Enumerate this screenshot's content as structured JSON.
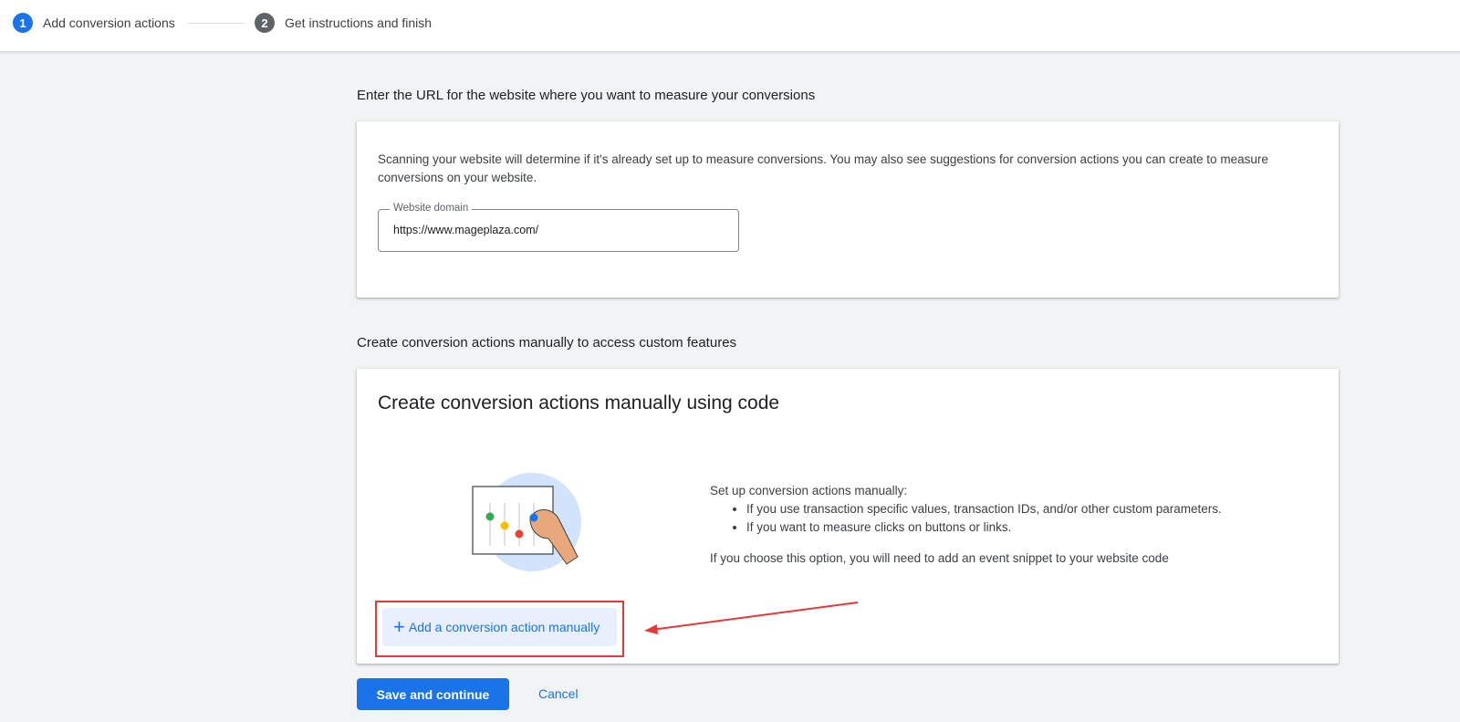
{
  "stepper": {
    "steps": [
      {
        "number": "1",
        "label": "Add conversion actions"
      },
      {
        "number": "2",
        "label": "Get instructions and finish"
      }
    ]
  },
  "url_section": {
    "title": "Enter the URL for the website where you want to measure your conversions",
    "description": "Scanning your website will determine if it's already set up to measure conversions. You may also see suggestions for conversion actions you can create to measure conversions on your website.",
    "field_label": "Website domain",
    "field_value": "https://www.mageplaza.com/"
  },
  "manual_section": {
    "title": "Create conversion actions manually to access custom features",
    "card_title": "Create conversion actions manually using code",
    "intro": "Set up conversion actions manually:",
    "bullets": [
      "If you use transaction specific values, transaction IDs, and/or other custom parameters.",
      "If you want to measure clicks on buttons or links."
    ],
    "note": "If you choose this option, you will need to add an event snippet to your website code",
    "add_button_label": "Add a conversion action manually"
  },
  "footer": {
    "save_label": "Save and continue",
    "cancel_label": "Cancel"
  },
  "colors": {
    "primary": "#1a73e8",
    "highlight": "#e53935"
  }
}
